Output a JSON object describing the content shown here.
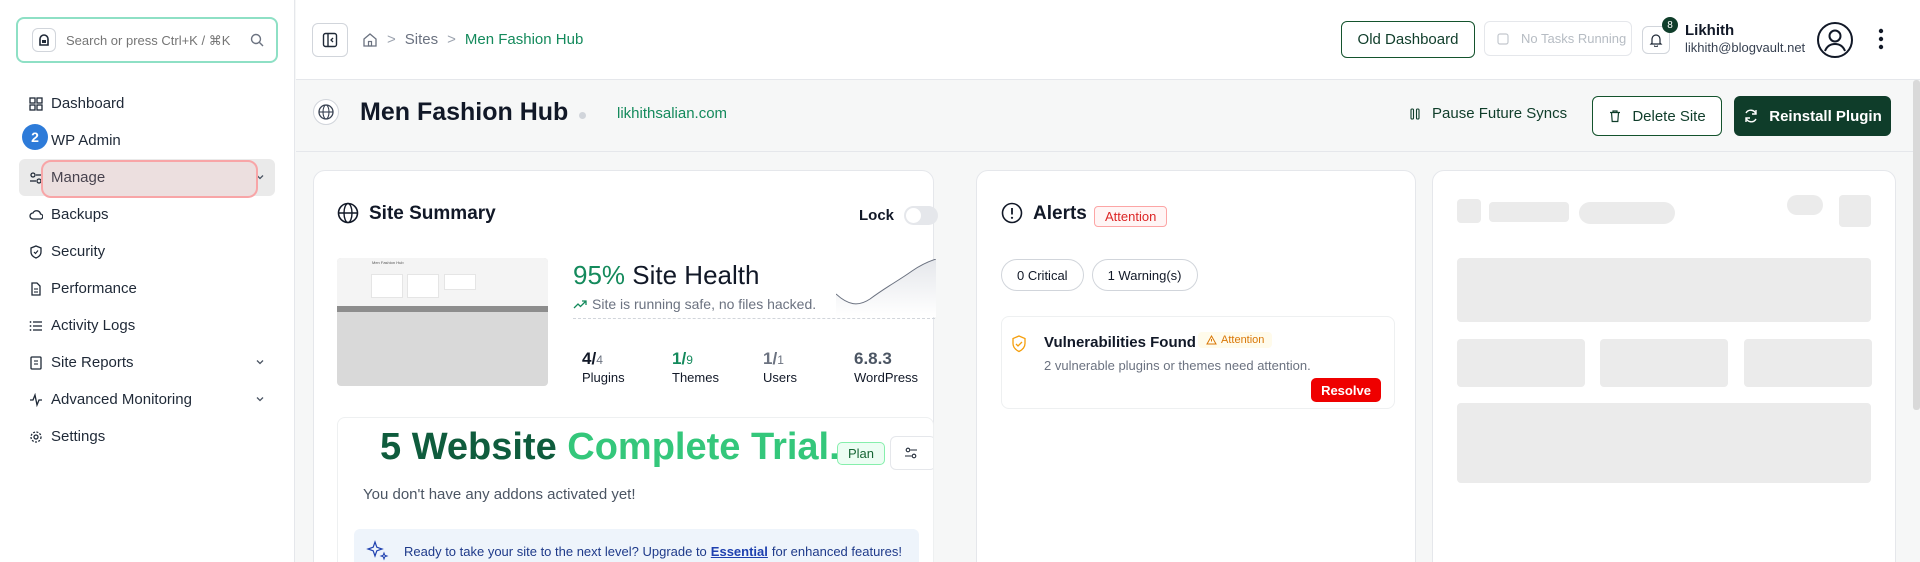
{
  "search": {
    "placeholder": "Search or press Ctrl+K / ⌘K"
  },
  "sidebar": {
    "items": [
      {
        "label": "Dashboard",
        "icon": "grid-icon"
      },
      {
        "label": "WP Admin",
        "icon": "wordpress-icon"
      },
      {
        "label": "Manage",
        "icon": "sliders-icon",
        "expandable": true,
        "active": true
      },
      {
        "label": "Backups",
        "icon": "cloud-icon"
      },
      {
        "label": "Security",
        "icon": "shield-icon"
      },
      {
        "label": "Performance",
        "icon": "file-icon"
      },
      {
        "label": "Activity Logs",
        "icon": "list-icon"
      },
      {
        "label": "Site Reports",
        "icon": "report-icon",
        "expandable": true
      },
      {
        "label": "Advanced Monitoring",
        "icon": "activity-icon",
        "expandable": true
      },
      {
        "label": "Settings",
        "icon": "gear-icon"
      }
    ],
    "step_badge": "2"
  },
  "breadcrumb": {
    "root": "Sites",
    "current": "Men Fashion Hub"
  },
  "header": {
    "old_dashboard": "Old Dashboard",
    "tasks": "No Tasks Running",
    "notifications": "8",
    "user_name": "Likhith",
    "user_email": "likhith@blogvault.net"
  },
  "site": {
    "title": "Men Fashion Hub",
    "url": "likhithsalian.com",
    "pause": "Pause Future Syncs",
    "delete": "Delete Site",
    "reinstall": "Reinstall Plugin"
  },
  "summary": {
    "title": "Site Summary",
    "lock": "Lock",
    "health_pct": "95%",
    "health_label": "Site Health",
    "health_sub": "Site is running safe, no files hacked.",
    "stats": [
      {
        "value": "4/",
        "total": "4",
        "label": "Plugins",
        "accent": false
      },
      {
        "value": "1/",
        "total": "9",
        "label": "Themes",
        "accent": true
      },
      {
        "value": "1/",
        "total": "1",
        "label": "Users",
        "accent": false
      },
      {
        "value": "6.8.3",
        "total": "",
        "label": "WordPress",
        "accent": false
      }
    ],
    "thumb_title": "Men Fashion Hub",
    "trial_a": "5 Website",
    "trial_b": "Complete Trial.",
    "plan": "Plan",
    "no_addons": "You don't have any addons activated yet!",
    "upgrade_pre": "Ready to take your site to the next level? Upgrade to",
    "upgrade_link": "Essential",
    "upgrade_post": "for enhanced features!"
  },
  "alerts": {
    "title": "Alerts",
    "badge": "Attention",
    "pills": [
      "0 Critical",
      "1 Warning(s)"
    ],
    "vuln_title": "Vulnerabilities Found",
    "vuln_badge": "Attention",
    "vuln_desc": "2 vulnerable plugins or themes need attention.",
    "resolve": "Resolve"
  },
  "colors": {
    "brand": "#0f3d2a",
    "accent": "#148a5c",
    "danger": "#ef0000"
  }
}
